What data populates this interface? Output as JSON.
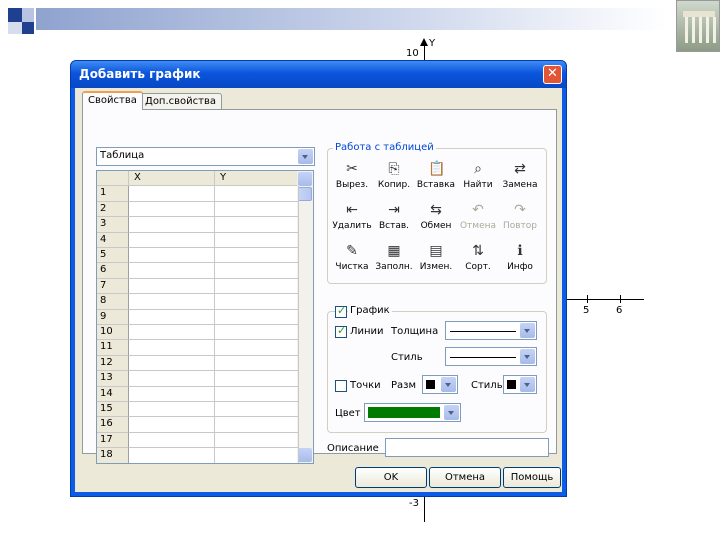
{
  "background": {
    "axis_labels": {
      "y_axis_name": "Y",
      "top_value": "10",
      "bottom_value": "-3",
      "x_tick_5": "5",
      "x_tick_6": "6"
    }
  },
  "dialog": {
    "title": "Добавить график",
    "tabs": [
      {
        "label": "Свойства",
        "active": true
      },
      {
        "label": "Доп.свойства",
        "active": false
      }
    ],
    "source_combo": {
      "value": "Таблица"
    },
    "table": {
      "columns": [
        "X",
        "Y"
      ],
      "row_numbers": [
        "1",
        "2",
        "3",
        "4",
        "5",
        "6",
        "7",
        "8",
        "9",
        "10",
        "11",
        "12",
        "13",
        "14",
        "15",
        "16",
        "17",
        "18"
      ]
    },
    "table_tools": {
      "title": "Работа с таблицей",
      "buttons": [
        {
          "label": "Вырез.",
          "icon": "scissors-icon",
          "glyph": "✂",
          "enabled": true
        },
        {
          "label": "Копир.",
          "icon": "copy-icon",
          "glyph": "⎘",
          "enabled": true
        },
        {
          "label": "Вставка",
          "icon": "paste-icon",
          "glyph": "📋",
          "enabled": true
        },
        {
          "label": "Найти",
          "icon": "binoculars-icon",
          "glyph": "⌕",
          "enabled": true
        },
        {
          "label": "Замена",
          "icon": "replace-icon",
          "glyph": "⇄",
          "enabled": true
        },
        {
          "label": "Удалить",
          "icon": "delete-row-icon",
          "glyph": "⇤",
          "enabled": true
        },
        {
          "label": "Встав.",
          "icon": "insert-row-icon",
          "glyph": "⇥",
          "enabled": true
        },
        {
          "label": "Обмен",
          "icon": "swap-icon",
          "glyph": "⇆",
          "enabled": true
        },
        {
          "label": "Отмена",
          "icon": "undo-icon",
          "glyph": "↶",
          "enabled": false
        },
        {
          "label": "Повтор",
          "icon": "redo-icon",
          "glyph": "↷",
          "enabled": false
        },
        {
          "label": "Чистка",
          "icon": "broom-icon",
          "glyph": "✎",
          "enabled": true
        },
        {
          "label": "Заполн.",
          "icon": "fill-icon",
          "glyph": "▦",
          "enabled": true
        },
        {
          "label": "Измен.",
          "icon": "edit-table-icon",
          "glyph": "▤",
          "enabled": true
        },
        {
          "label": "Сорт.",
          "icon": "sort-icon",
          "glyph": "⇅",
          "enabled": true
        },
        {
          "label": "Инфо",
          "icon": "info-icon",
          "glyph": "ℹ",
          "enabled": true
        }
      ]
    },
    "graph_group": {
      "title": "График",
      "checked": true,
      "lines": {
        "label": "Линии",
        "checked": true
      },
      "thickness_label": "Толщина",
      "style_label": "Стиль",
      "points": {
        "label": "Точки",
        "checked": false
      },
      "size_label": "Разм",
      "point_style_label": "Стиль",
      "color_label": "Цвет",
      "color_value": "#007a00"
    },
    "description_label": "Описание",
    "description_value": "",
    "buttons": {
      "ok": "OK",
      "cancel": "Отмена",
      "help": "Помощь"
    }
  }
}
